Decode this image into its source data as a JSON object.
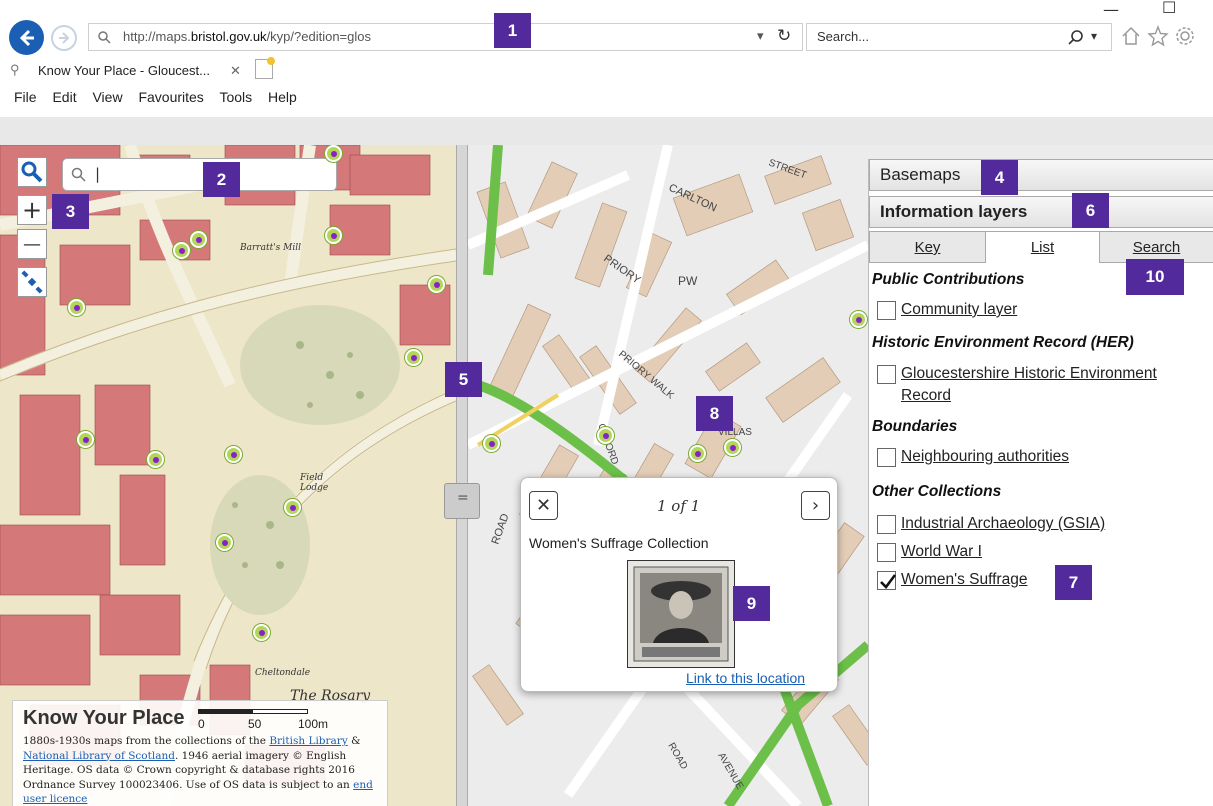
{
  "browser": {
    "url_prefix": "http://maps.",
    "url_domain": "bristol.gov.uk",
    "url_path": "/kyp/?edition=glos",
    "search_placeholder": "Search...",
    "tab_title": "Know Your Place - Gloucest...",
    "menu": [
      "File",
      "Edit",
      "View",
      "Favourites",
      "Tools",
      "Help"
    ]
  },
  "map": {
    "search_value": "|",
    "zoom_in": "+",
    "zoom_out": "—",
    "divider_handle": "="
  },
  "panel": {
    "basemaps": "Basemaps",
    "info_layers": "Information layers",
    "tabs": [
      "Key",
      "List",
      "Search"
    ],
    "sections": {
      "public": "Public Contributions",
      "her": "Historic Environment Record (HER)",
      "boundaries": "Boundaries",
      "other": "Other Collections"
    },
    "items": {
      "community": "Community layer",
      "gher_1": "Gloucestershire Historic Environment",
      "gher_2": "Record",
      "neighbouring": "Neighbouring authorities",
      "gsia": "Industrial Archaeology (GSIA)",
      "ww1": "World War I",
      "suffrage": "Women's Suffrage"
    },
    "checked": {
      "suffrage": true
    }
  },
  "popup": {
    "count": "1 of 1",
    "collection": "Women's Suffrage Collection",
    "link": "Link to this location"
  },
  "attribution": {
    "brand": "Know Your Place",
    "scale_0": "0",
    "scale_50": "50",
    "scale_100": "100m",
    "line1": "1880s-1930s maps from the collections of the",
    "link_bl": "British Library",
    "amp": " &",
    "link_nls": "National Library of Scotland",
    "line2": ". 1946 aerial imagery © English Heritage. OS data © Crown copyright & database rights 2016 Ordnance Survey 100023406. Use of OS data is subject to an",
    "link_ul": "end user licence"
  },
  "badges": [
    "1",
    "2",
    "3",
    "4",
    "5",
    "6",
    "7",
    "8",
    "9",
    "10"
  ],
  "colors": {
    "badge": "#522a9c",
    "link": "#1a5fb4",
    "marker_ring": "#b2d65a",
    "marker_dot": "#8a20c8"
  }
}
